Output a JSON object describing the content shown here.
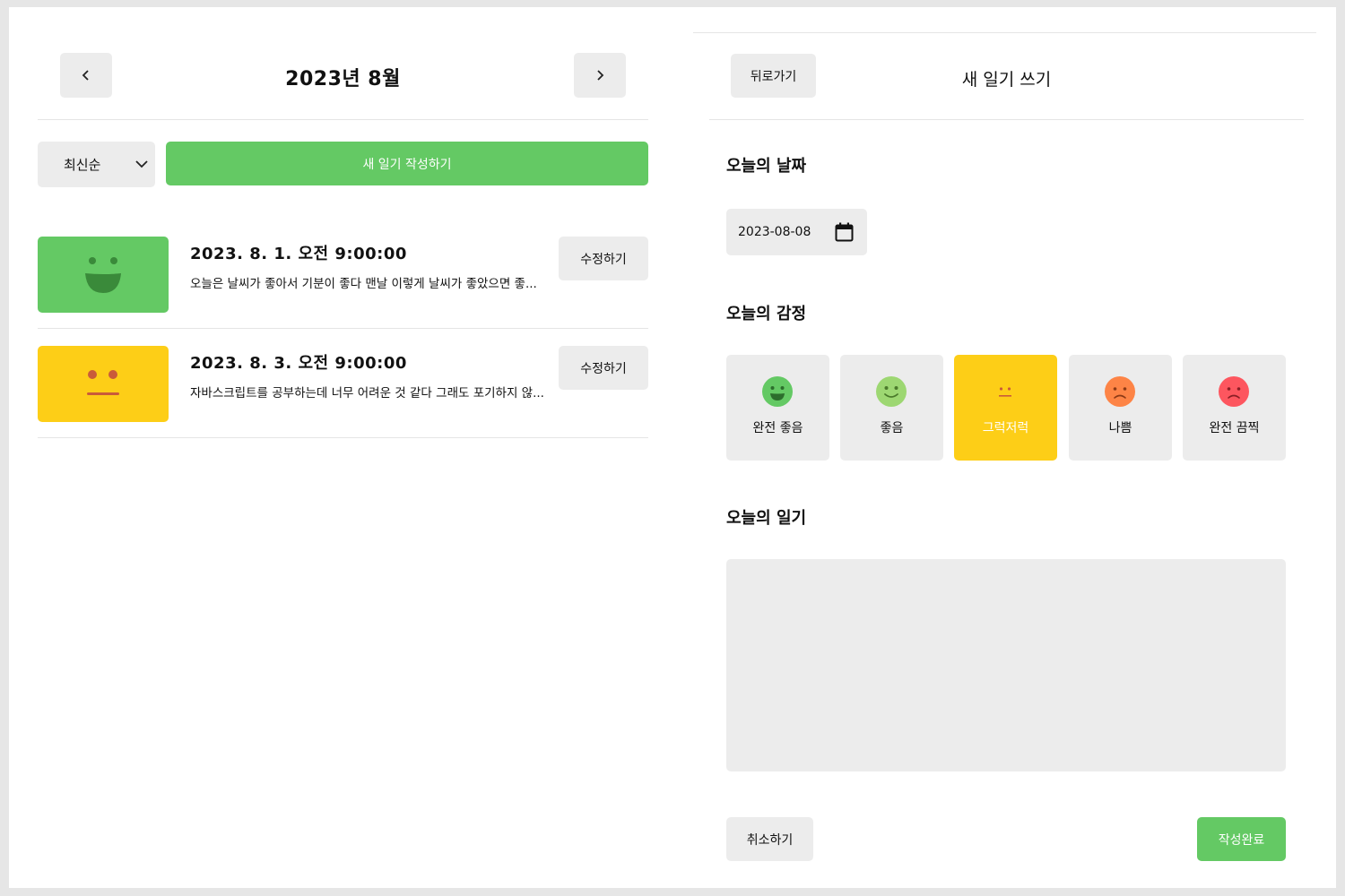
{
  "list": {
    "header": {
      "prev_label": "<",
      "next_label": ">",
      "month": "2023년 8월"
    },
    "sort": {
      "selected": "최신순"
    },
    "new_button": "새 일기 작성하기",
    "entries": [
      {
        "date": "2023. 8. 1. 오전 9:00:00",
        "content": "오늘은 날씨가 좋아서 기분이 좋다 맨날 이렇게 날씨가 좋았으면 좋...",
        "emotion": "완전 좋음",
        "color": "#64c964",
        "edit_label": "수정하기"
      },
      {
        "date": "2023. 8. 3. 오전 9:00:00",
        "content": "자바스크립트를 공부하는데 너무 어려운 것 같다 그래도 포기하지 않...",
        "emotion": "그럭저럭",
        "color": "#fdce17",
        "edit_label": "수정하기"
      }
    ]
  },
  "editor": {
    "back_label": "뒤로가기",
    "title": "새 일기 쓰기",
    "date_section": "오늘의 날짜",
    "date_value": "2023-08-08",
    "emotion_section": "오늘의 감정",
    "emotions": [
      {
        "label": "완전 좋음",
        "color": "#64c964",
        "icon": "very-happy-face-icon",
        "selected": false
      },
      {
        "label": "좋음",
        "color": "#9dd772",
        "icon": "happy-face-icon",
        "selected": false
      },
      {
        "label": "그럭저럭",
        "color": "#fdce17",
        "icon": "neutral-face-icon",
        "selected": true
      },
      {
        "label": "나쁨",
        "color": "#fd8446",
        "icon": "sad-face-icon",
        "selected": false
      },
      {
        "label": "완전 끔찍",
        "color": "#fd565f",
        "icon": "very-sad-face-icon",
        "selected": false
      }
    ],
    "diary_section": "오늘의 일기",
    "diary_value": "",
    "cancel_label": "취소하기",
    "submit_label": "작성완료"
  },
  "colors": {
    "accent_green": "#64c964",
    "button_gray": "#ececec",
    "selected_yellow": "#fdce17"
  }
}
